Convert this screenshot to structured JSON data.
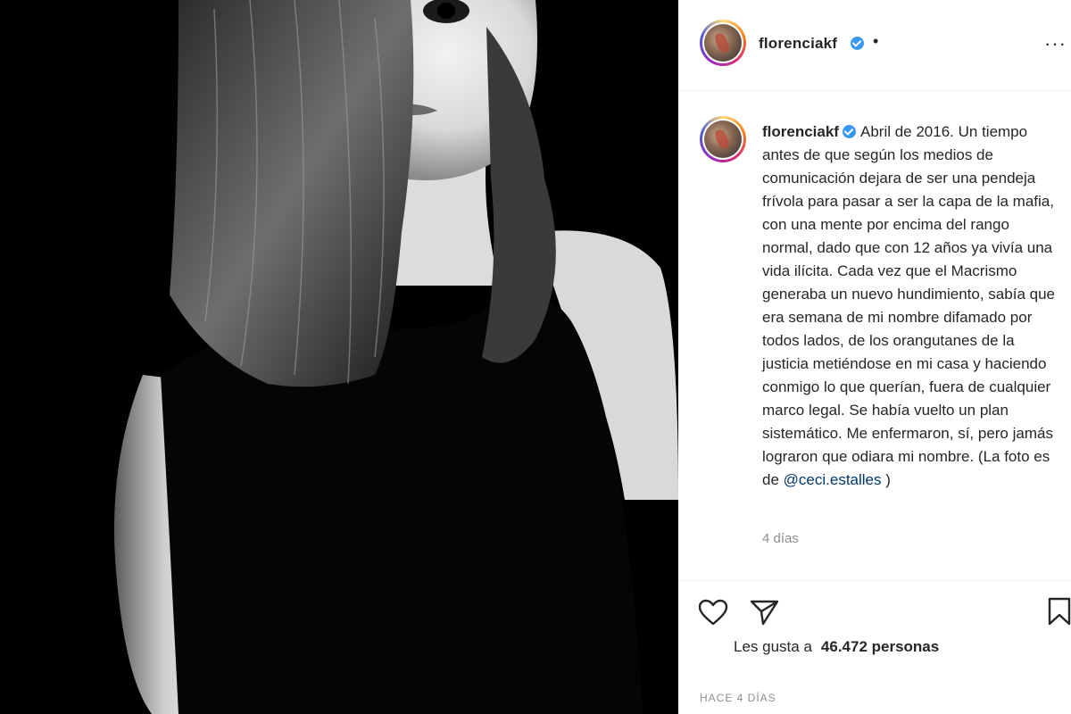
{
  "post": {
    "username": "florenciakf",
    "header_separator": "•",
    "more_options": "···",
    "caption_text": "Abril de 2016. Un tiempo antes de que según los medios de comunicación dejara de ser una pendeja frívola para pasar a ser la capa de la mafia, con una mente por encima del rango normal, dado que con 12 años ya vivía una vida ilícita. Cada vez que el Macrismo generaba un nuevo hundimiento, sabía que era semana de mi nombre difamado por todos lados, de los orangutanes de la justicia metiéndose en mi casa y haciendo conmigo lo que querían, fuera de cualquier marco legal. Se había vuelto un plan sistemático. Me enfermaron, sí, pero jamás lograron que odiara mi nombre. (La foto es de",
    "caption_mention": "@ceci.estalles",
    "caption_end": ")",
    "time_ago": "4 días",
    "likes_prefix": "Les gusta a",
    "likes_count": "46.472 personas",
    "post_date": "HACE 4 DÍAS"
  },
  "icons": {
    "verified": "verified-badge-icon",
    "heart": "heart-icon",
    "send": "paper-plane-icon",
    "save": "bookmark-icon",
    "more": "ellipsis-icon"
  },
  "colors": {
    "verified": "#3897f0",
    "text": "#262626",
    "muted": "#8e8e8e",
    "mention": "#00376b",
    "divider": "#efefef"
  }
}
